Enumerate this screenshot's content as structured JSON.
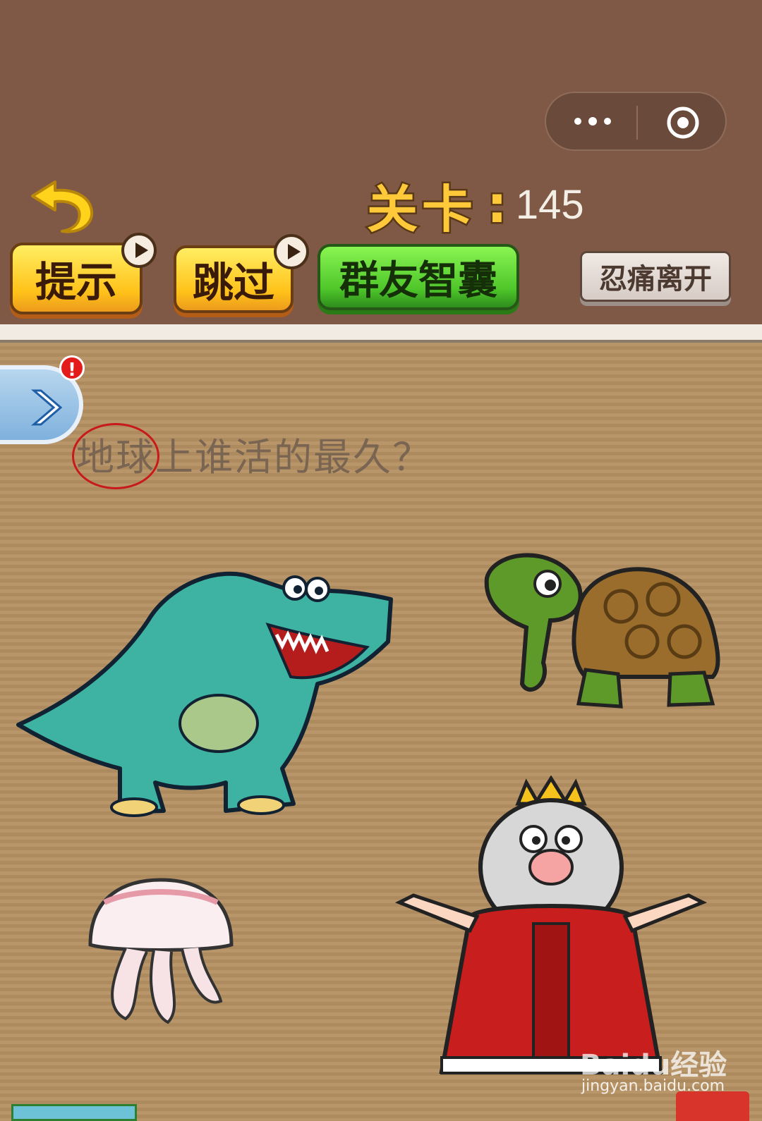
{
  "header": {
    "level_label": "关卡",
    "level_colon": ":",
    "level_number": "145"
  },
  "toolbar": {
    "hint_label": "提示",
    "skip_label": "跳过",
    "friends_label": "群友智囊",
    "quit_label": "忍痛离开"
  },
  "question": {
    "text": "地球上谁活的最久？"
  },
  "watermark": {
    "brand": "Baidu经验",
    "url": "jingyan.baidu.com"
  },
  "notification": {
    "badge": "!"
  },
  "options": [
    "dinosaur",
    "turtle",
    "jellyfish",
    "king"
  ]
}
